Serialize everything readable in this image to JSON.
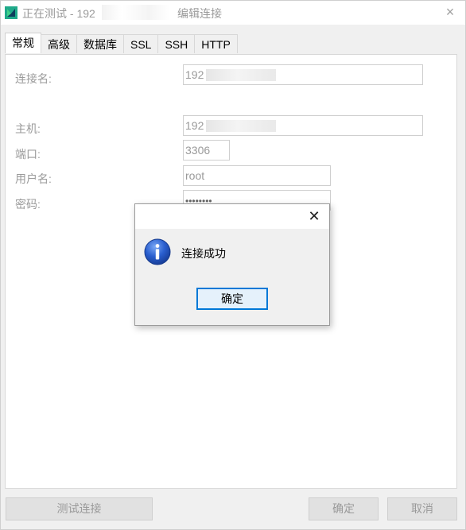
{
  "window": {
    "title_prefix": "正在测试 - 192",
    "title_suffix": "编辑连接",
    "close_glyph": "×"
  },
  "tabs": [
    {
      "label": "常规",
      "active": true
    },
    {
      "label": "高级"
    },
    {
      "label": "数据库"
    },
    {
      "label": "SSL"
    },
    {
      "label": "SSH"
    },
    {
      "label": "HTTP"
    }
  ],
  "form": {
    "connection_name_label": "连接名:",
    "connection_name_value": "192",
    "host_label": "主机:",
    "host_value": "192",
    "port_label": "端口:",
    "port_value": "3306",
    "username_label": "用户名:",
    "username_value": "root",
    "password_label": "密码:",
    "password_value": "••••••••"
  },
  "footer": {
    "test_button": "测试连接",
    "ok_button": "确定",
    "cancel_button": "取消"
  },
  "dialog": {
    "close_glyph": "✕",
    "message": "连接成功",
    "ok_button": "确定",
    "icon": "info-icon"
  },
  "colors": {
    "accent": "#0078d7",
    "info_blue": "#2a5fcf",
    "brand": "#1faa8a"
  }
}
